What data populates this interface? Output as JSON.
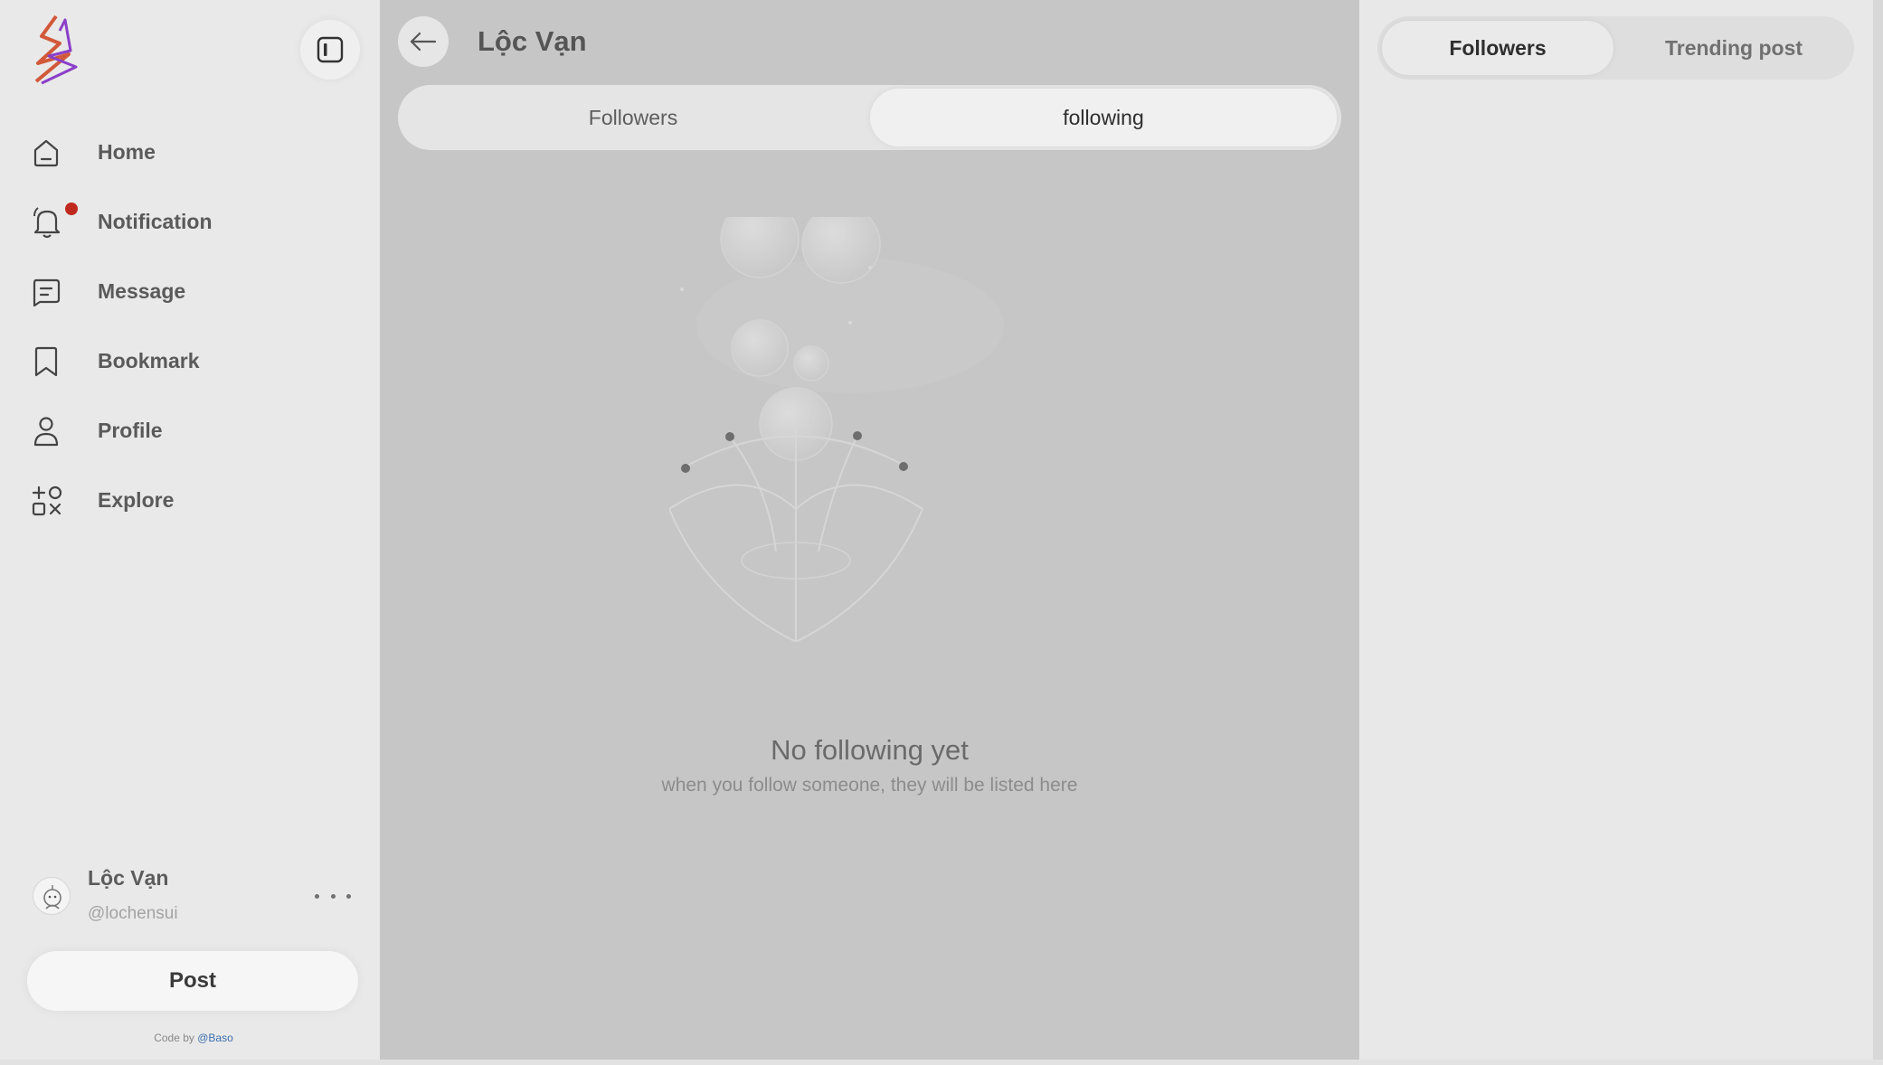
{
  "sidebar": {
    "nav": [
      {
        "label": "Home",
        "icon": "home-icon"
      },
      {
        "label": "Notification",
        "icon": "bell-icon",
        "has_badge": true
      },
      {
        "label": "Message",
        "icon": "message-icon"
      },
      {
        "label": "Bookmark",
        "icon": "bookmark-icon"
      },
      {
        "label": "Profile",
        "icon": "user-icon"
      },
      {
        "label": "Explore",
        "icon": "explore-icon"
      }
    ],
    "user": {
      "name": "Lộc Vạn",
      "handle": "@lochensui"
    },
    "post_label": "Post",
    "credit_prefix": "Code by ",
    "credit_author": "@Baso"
  },
  "main": {
    "title": "Lộc Vạn",
    "tabs": [
      {
        "label": "Followers",
        "active": false
      },
      {
        "label": "following",
        "active": true
      }
    ],
    "empty_title": "No following yet",
    "empty_subtitle": "when you follow someone, they will be listed here"
  },
  "right": {
    "tabs": [
      {
        "label": "Followers",
        "active": true
      },
      {
        "label": "Trending post",
        "active": false
      }
    ]
  },
  "colors": {
    "notification_badge": "#c0291e",
    "main_background": "#c6c6c6",
    "sidebar_background": "#e9e9e9",
    "credit_link": "#3b6fb0"
  }
}
